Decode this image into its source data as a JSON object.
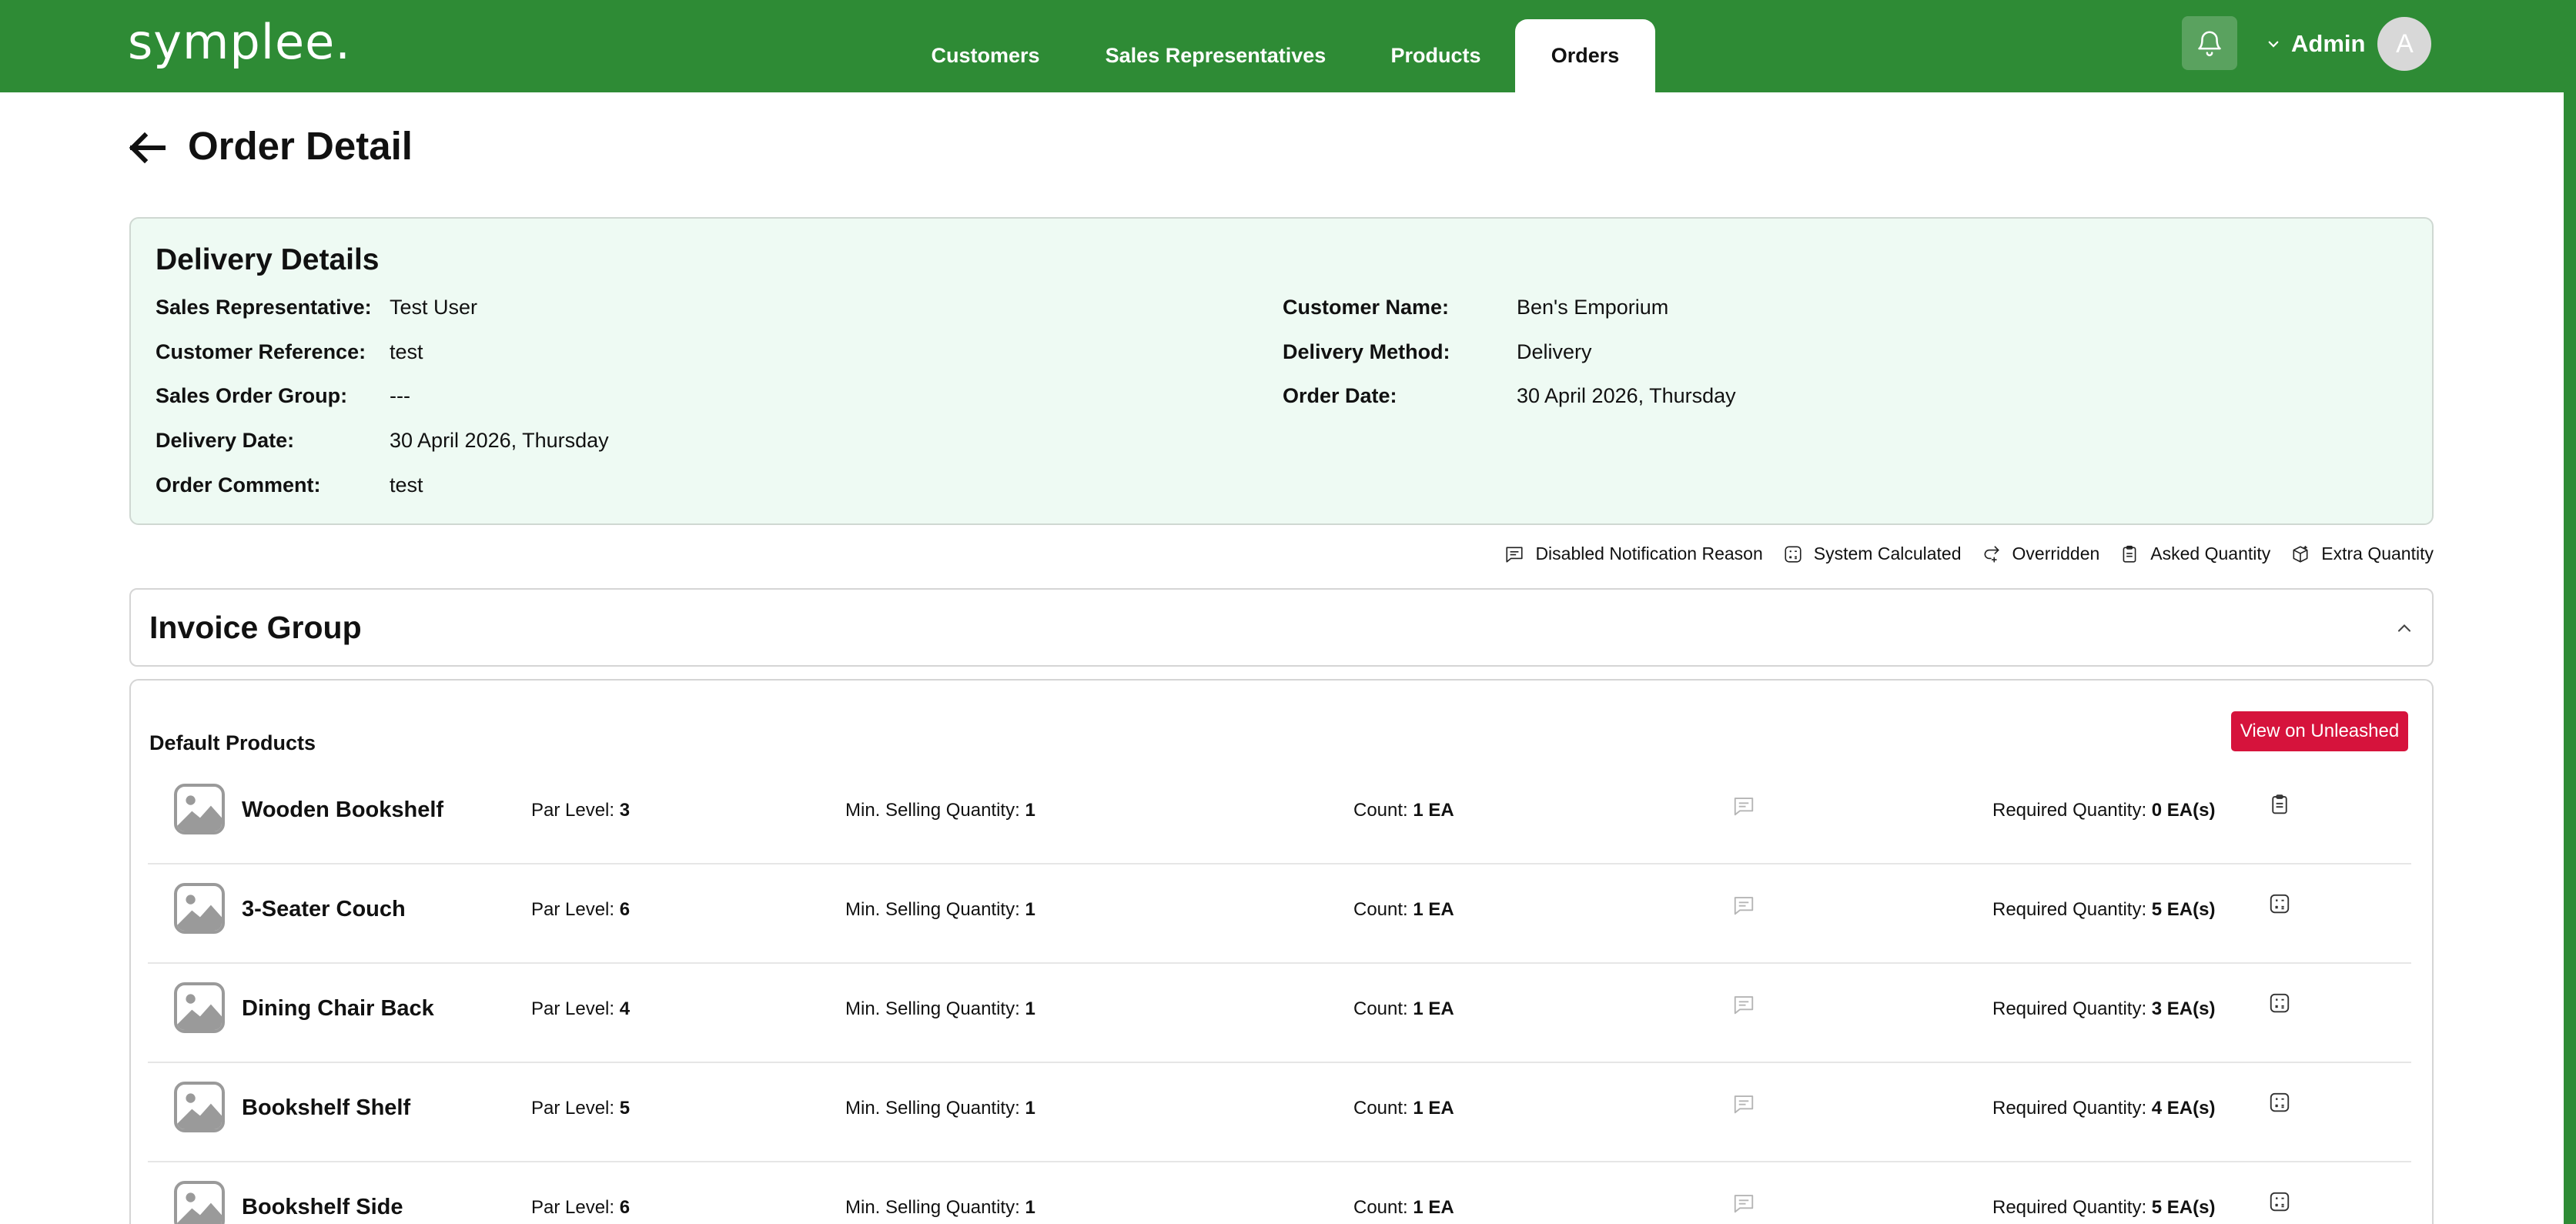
{
  "app": {
    "logo": "symplee.",
    "colors": {
      "brand_green": "#2e8b35",
      "accent_red": "#d6133c",
      "card_bg": "#eefaf3"
    }
  },
  "nav": {
    "items": [
      {
        "label": "Customers",
        "active": false
      },
      {
        "label": "Sales Representatives",
        "active": false
      },
      {
        "label": "Products",
        "active": false
      },
      {
        "label": "Orders",
        "active": true
      }
    ]
  },
  "user": {
    "name": "Admin",
    "initial": "A"
  },
  "page": {
    "title": "Order Detail"
  },
  "delivery": {
    "title": "Delivery Details",
    "left": [
      {
        "label": "Sales Representative:",
        "value": "Test User"
      },
      {
        "label": "Customer Reference:",
        "value": "test"
      },
      {
        "label": "Sales Order Group:",
        "value": "---"
      },
      {
        "label": "Delivery Date:",
        "value": "30 April 2026, Thursday"
      },
      {
        "label": "Order Comment:",
        "value": "test"
      }
    ],
    "right": [
      {
        "label": "Customer Name:",
        "value": "Ben's Emporium"
      },
      {
        "label": "Delivery Method:",
        "value": "Delivery"
      },
      {
        "label": "Order Date:",
        "value": "30 April 2026, Thursday"
      }
    ]
  },
  "legend": [
    {
      "icon": "comment-icon",
      "label": "Disabled Notification Reason"
    },
    {
      "icon": "calculator-icon",
      "label": "System Calculated"
    },
    {
      "icon": "override-icon",
      "label": "Overridden"
    },
    {
      "icon": "clipboard-icon",
      "label": "Asked Quantity"
    },
    {
      "icon": "box-plus-icon",
      "label": "Extra Quantity"
    }
  ],
  "invoice_group": {
    "title": "Invoice Group",
    "section_title": "Default Products",
    "view_button": "View on Unleashed",
    "labels": {
      "par": "Par Level:",
      "min": "Min. Selling Quantity:",
      "count": "Count:",
      "required": "Required Quantity:"
    },
    "products": [
      {
        "name": "Wooden Bookshelf",
        "par": "3",
        "min": "1",
        "count": "1 EA",
        "required": "0 EA(s)",
        "status_icon": "clipboard-icon"
      },
      {
        "name": "3-Seater Couch",
        "par": "6",
        "min": "1",
        "count": "1 EA",
        "required": "5 EA(s)",
        "status_icon": "calculator-icon"
      },
      {
        "name": "Dining Chair Back",
        "par": "4",
        "min": "1",
        "count": "1 EA",
        "required": "3 EA(s)",
        "status_icon": "calculator-icon"
      },
      {
        "name": "Bookshelf Shelf",
        "par": "5",
        "min": "1",
        "count": "1 EA",
        "required": "4 EA(s)",
        "status_icon": "calculator-icon"
      },
      {
        "name": "Bookshelf Side",
        "par": "6",
        "min": "1",
        "count": "1 EA",
        "required": "5 EA(s)",
        "status_icon": "calculator-icon"
      }
    ]
  }
}
